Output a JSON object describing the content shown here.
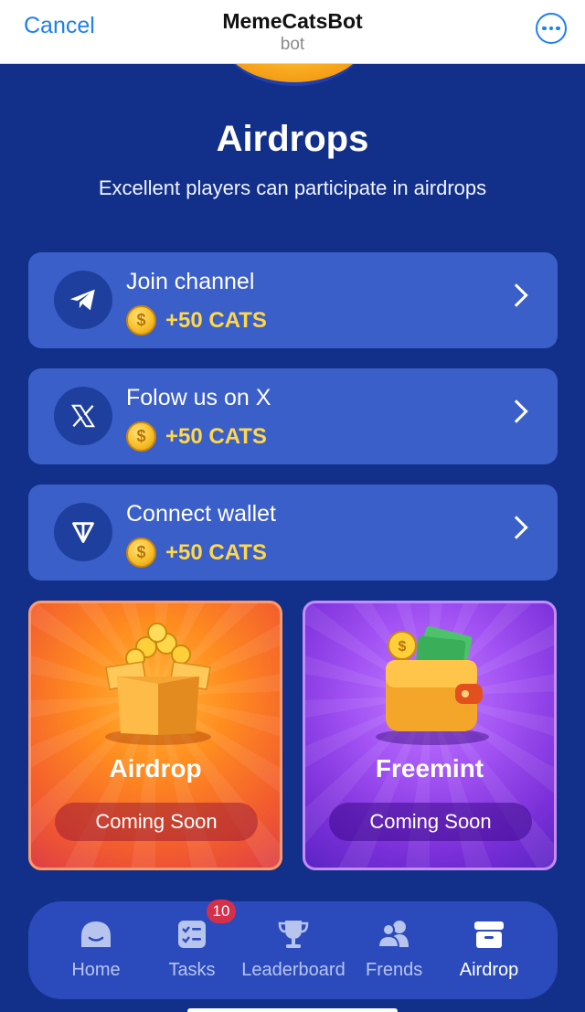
{
  "header": {
    "cancel_label": "Cancel",
    "title": "MemeCatsBot",
    "subtitle": "bot"
  },
  "page": {
    "heading": "Airdrops",
    "subheading": "Excellent players can participate in airdrops"
  },
  "tasks": [
    {
      "icon": "telegram-icon",
      "label": "Join channel",
      "reward": "+50 CATS"
    },
    {
      "icon": "x-logo-icon",
      "label": "Folow us on X",
      "reward": "+50 CATS"
    },
    {
      "icon": "ton-icon",
      "label": "Connect wallet",
      "reward": "+50 CATS"
    }
  ],
  "cards": [
    {
      "title": "Airdrop",
      "status": "Coming Soon",
      "icon": "treasure-box-icon",
      "color": "#ff8c1f"
    },
    {
      "title": "Freemint",
      "status": "Coming Soon",
      "icon": "wallet-icon",
      "color": "#a050f2"
    }
  ],
  "nav": {
    "items": [
      {
        "label": "Home",
        "icon": "home-icon"
      },
      {
        "label": "Tasks",
        "icon": "tasks-icon",
        "badge": "10"
      },
      {
        "label": "Leaderboard",
        "icon": "trophy-icon"
      },
      {
        "label": "Frends",
        "icon": "friends-icon"
      },
      {
        "label": "Airdrop",
        "icon": "airdrop-icon",
        "active": true
      }
    ]
  },
  "colors": {
    "background": "#12308a",
    "card": "#3b5fc9",
    "accent": "#1e7ff0",
    "reward": "#ffd84a",
    "badge": "#d52f4a"
  }
}
